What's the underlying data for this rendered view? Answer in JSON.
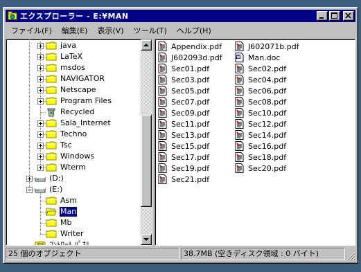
{
  "window": {
    "title": "エクスプローラー - E:¥MAN",
    "minimize_icon": "minimize-icon",
    "maximize_icon": "maximize-icon",
    "close_icon": "close-icon"
  },
  "menu": [
    "ファイル(F)",
    "編集(E)",
    "表示(V)",
    "ツール(T)",
    "ヘルプ(H)"
  ],
  "tree": {
    "items": [
      {
        "label": "java",
        "icon": "folder-icon"
      },
      {
        "label": "LaTeX",
        "icon": "folder-icon"
      },
      {
        "label": "msdos",
        "icon": "folder-icon"
      },
      {
        "label": "NAVIGATOR",
        "icon": "folder-icon"
      },
      {
        "label": "Netscape",
        "icon": "folder-icon"
      },
      {
        "label": "Program Files",
        "icon": "folder-icon"
      },
      {
        "label": "Recycled",
        "icon": "recycle-bin-icon"
      },
      {
        "label": "Sala_Internet",
        "icon": "folder-icon"
      },
      {
        "label": "Techno",
        "icon": "folder-icon"
      },
      {
        "label": "Tsc",
        "icon": "folder-icon"
      },
      {
        "label": "Windows",
        "icon": "folder-icon"
      },
      {
        "label": "Wterm",
        "icon": "folder-icon"
      },
      {
        "label": "(D:)",
        "icon": "drive-icon"
      },
      {
        "label": "(E:)",
        "icon": "drive-icon"
      },
      {
        "label": "Asm",
        "icon": "folder-icon"
      },
      {
        "label": "Man",
        "icon": "open-folder-icon",
        "selected": true
      },
      {
        "label": "Mb",
        "icon": "folder-icon"
      },
      {
        "label": "Writer",
        "icon": "folder-icon"
      },
      {
        "label": "ｺﾝﾄﾛｰﾙ ﾊﾟﾈﾙ",
        "icon": "control-panel-icon"
      }
    ]
  },
  "files": {
    "col1": [
      "Appendix.pdf",
      "J602093d.pdf",
      "Sec01.pdf",
      "Sec03.pdf",
      "Sec05.pdf",
      "Sec07.pdf",
      "Sec09.pdf",
      "Sec11.pdf",
      "Sec13.pdf",
      "Sec15.pdf",
      "Sec17.pdf",
      "Sec19.pdf",
      "Sec21.pdf"
    ],
    "col2": [
      "J602071b.pdf",
      "Man.doc",
      "Sec02.pdf",
      "Sec04.pdf",
      "Sec06.pdf",
      "Sec08.pdf",
      "Sec10.pdf",
      "Sec12.pdf",
      "Sec14.pdf",
      "Sec16.pdf",
      "Sec18.pdf",
      "Sec20.pdf"
    ]
  },
  "status": {
    "count": "25 個のオブジェクト",
    "size": "38.7MB (空きディスク領域 : 0 バイト)"
  },
  "colors": {
    "titlebar": "#000080",
    "desktop": "#3c5f80",
    "face": "#c0c0c0"
  }
}
